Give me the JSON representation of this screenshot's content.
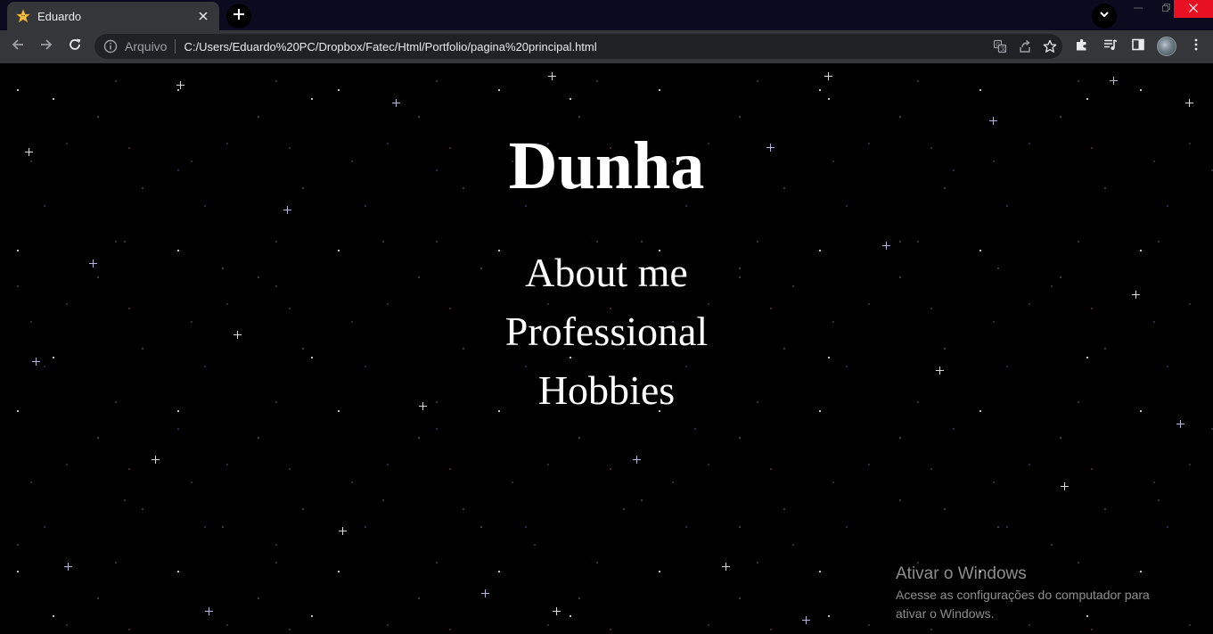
{
  "browser": {
    "tab": {
      "title": "Eduardo",
      "favicon": "star-icon"
    },
    "omnibox": {
      "scheme_label": "Arquivo",
      "url": "C:/Users/Eduardo%20PC/Dropbox/Fatec/Html/Portfolio/pagina%20principal.html"
    },
    "colors": {
      "tabstrip": "#0b0a1f",
      "toolbar": "#35363a",
      "omnibox": "#202124",
      "close_button": "#e81123"
    }
  },
  "page": {
    "title": "Dunha",
    "menu": [
      {
        "label": "About me"
      },
      {
        "label": "Professional"
      },
      {
        "label": "Hobbies"
      }
    ],
    "background": "starfield"
  },
  "windows_activation": {
    "title": "Ativar o Windows",
    "line1": "Acesse as configurações do computador para",
    "line2": "ativar o Windows."
  }
}
